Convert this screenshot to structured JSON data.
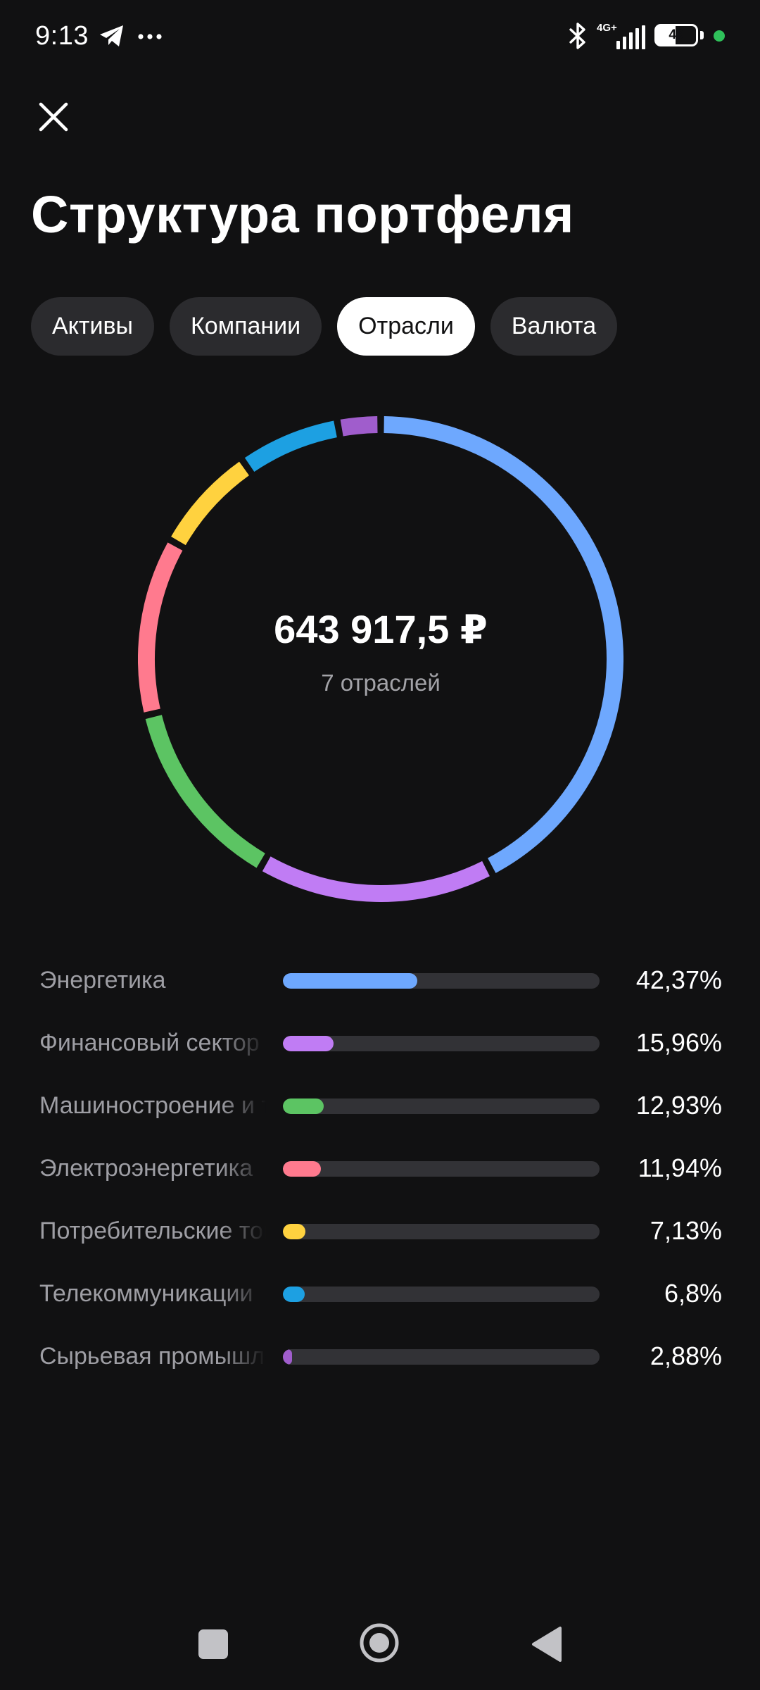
{
  "status_bar": {
    "time": "9:13",
    "network": "4G+",
    "battery": "49",
    "battery_fraction": 0.49
  },
  "header": {
    "close_icon": "close-icon",
    "title": "Структура портфеля"
  },
  "tabs": [
    {
      "label": "Активы",
      "active": false
    },
    {
      "label": "Компании",
      "active": false
    },
    {
      "label": "Отрасли",
      "active": true
    },
    {
      "label": "Валюта",
      "active": false
    }
  ],
  "summary": {
    "total": "643 917,5 ₽",
    "count_label": "7 отраслей"
  },
  "sectors": [
    {
      "name": "Энергетика",
      "percent_label": "42,37%",
      "percent": 42.37,
      "color": "#6ea8fe"
    },
    {
      "name": "Финансовый сектор",
      "percent_label": "15,96%",
      "percent": 15.96,
      "color": "#c07cf4"
    },
    {
      "name": "Машиностроение и транспорт",
      "percent_label": "12,93%",
      "percent": 12.93,
      "color": "#5cc463"
    },
    {
      "name": "Электроэнергетика",
      "percent_label": "11,94%",
      "percent": 11.94,
      "color": "#ff7a8e"
    },
    {
      "name": "Потребительские товары",
      "percent_label": "7,13%",
      "percent": 7.13,
      "color": "#ffd23f"
    },
    {
      "name": "Телекоммуникации",
      "percent_label": "6,8%",
      "percent": 6.8,
      "color": "#1da0e2"
    },
    {
      "name": "Сырьевая промышленность",
      "percent_label": "2,88%",
      "percent": 2.88,
      "color": "#a05dcc"
    }
  ],
  "nav_bar": {
    "icons": [
      "recents-square-icon",
      "home-circle-icon",
      "back-triangle-icon"
    ]
  }
}
